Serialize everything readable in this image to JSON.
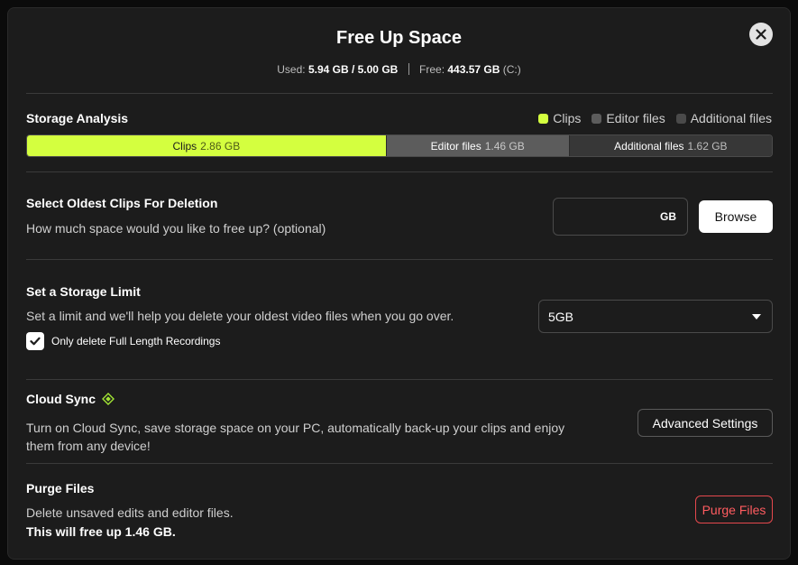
{
  "modal": {
    "title": "Free Up Space",
    "usage": {
      "used_label": "Used:",
      "used_value": "5.94 GB / 5.00 GB",
      "free_label": "Free:",
      "free_value": "443.57 GB",
      "drive": "(C:)"
    }
  },
  "storage_analysis": {
    "title": "Storage Analysis",
    "legend": [
      {
        "label": "Clips",
        "color": "#d4ff3f"
      },
      {
        "label": "Editor files",
        "color": "#5c5c5c"
      },
      {
        "label": "Additional files",
        "color": "#373737"
      }
    ],
    "bar": [
      {
        "label": "Clips",
        "value": "2.86 GB",
        "gb": 2.86
      },
      {
        "label": "Editor files",
        "value": "1.46 GB",
        "gb": 1.46
      },
      {
        "label": "Additional files",
        "value": "1.62 GB",
        "gb": 1.62
      }
    ]
  },
  "select_oldest": {
    "title": "Select Oldest Clips For Deletion",
    "description": "How much space would you like to free up? (optional)",
    "input_value": "",
    "unit": "GB",
    "browse_label": "Browse"
  },
  "storage_limit": {
    "title": "Set a Storage Limit",
    "description": "Set a limit and we'll help you delete your oldest video files when you go over.",
    "selected": "5GB",
    "checkbox_label": "Only delete Full Length Recordings",
    "checkbox_checked": true
  },
  "cloud_sync": {
    "title": "Cloud Sync",
    "description_line1": "Turn on Cloud Sync, save storage space on your PC, automatically back-up your clips and enjoy",
    "description_line2": "them from any device!",
    "button_label": "Advanced Settings",
    "icon": "diamond-icon",
    "accent": "#a3e635"
  },
  "purge": {
    "title": "Purge Files",
    "description": "Delete unsaved edits and editor files.",
    "note": "This will free up 1.46 GB.",
    "button_label": "Purge Files",
    "danger_color": "#e5484d"
  },
  "colors": {
    "background": "#1c1c1c",
    "clips_accent": "#d4ff3f"
  }
}
